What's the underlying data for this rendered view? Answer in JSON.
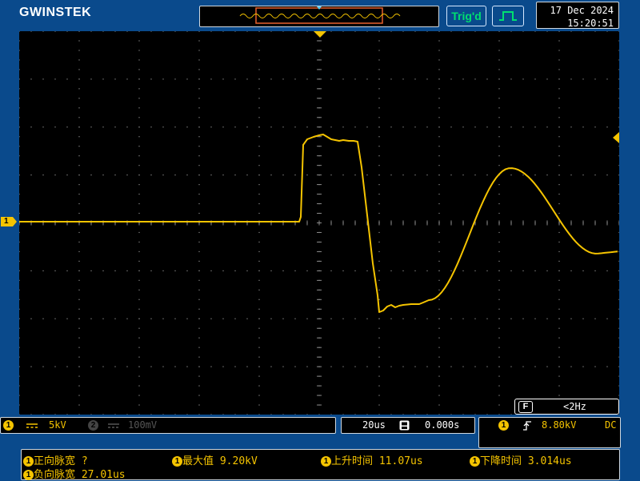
{
  "header": {
    "brand": "GWINSTEK",
    "trigger_status": "Trig'd",
    "trigger_mode_icon": "pulse-trigger-icon",
    "date": "17 Dec 2024",
    "time": "15:20:51"
  },
  "channel_marker": "1",
  "frequency": {
    "badge": "F",
    "value": "<2Hz"
  },
  "channel_bar": {
    "ch1_badge": "1",
    "ch1_coupling_icon": "dc-coupling-icon",
    "ch1_scale": "5kV",
    "ch2_badge": "2",
    "ch2_scale": "100mV"
  },
  "timebase": {
    "scale": "20us",
    "position_icon": "horizontal-position-icon",
    "position": "0.000s"
  },
  "trigger": {
    "source_badge": "1",
    "slope_icon": "rising-edge-icon",
    "level": "8.80kV",
    "coupling": "DC"
  },
  "measurements": [
    {
      "badge": "1",
      "label": "正向脉宽",
      "value": "?"
    },
    {
      "badge": "1",
      "label": "最大值",
      "value": "9.20kV"
    },
    {
      "badge": "1",
      "label": "上升时间",
      "value": "11.07us"
    },
    {
      "badge": "1",
      "label": "下降时间",
      "value": "3.014us"
    },
    {
      "badge": "1",
      "label": "负向脉宽",
      "value": "27.01us"
    }
  ],
  "colors": {
    "background": "#0a4a8c",
    "trace": "#f5c400",
    "trigger_status": "#00e070",
    "grid": "#8a8a8a"
  }
}
